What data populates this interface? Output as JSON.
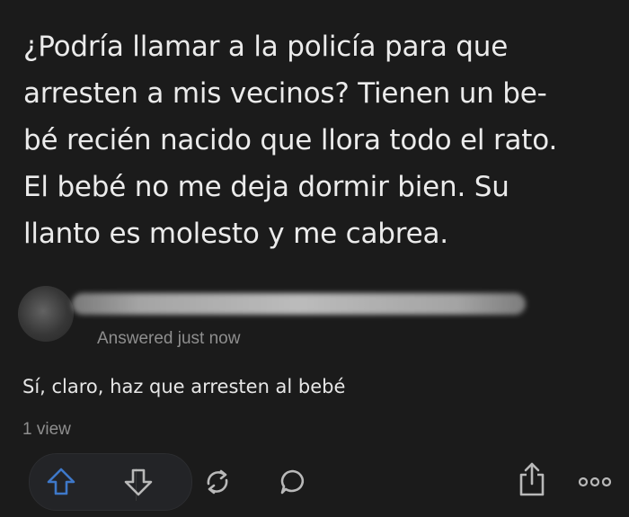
{
  "question": {
    "lines": [
      "¿Podría llamar a la policía para que",
      "arresten a mis vecinos? Tienen un be-",
      "bé recién nacido que llora todo el rato.",
      "El bebé no me deja dormir bien. Su",
      "llanto es molesto y me cabrea."
    ]
  },
  "answer": {
    "meta": "Answered just now",
    "text": "Sí, claro, haz que arresten al bebé",
    "views": "1 view"
  },
  "actions": {
    "upvote_color": "#3e78c9",
    "icon_color": "#b9b9b9"
  }
}
